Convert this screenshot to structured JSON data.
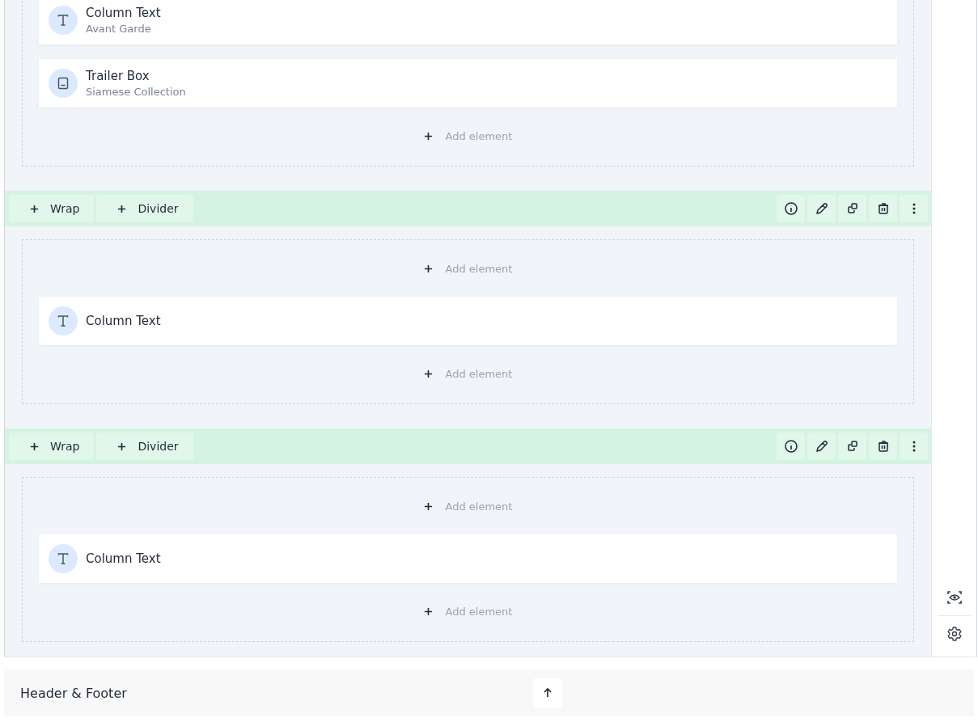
{
  "rows": [
    {
      "kind": "section",
      "add_top": null,
      "elements": [
        {
          "kind": "text",
          "title": "Column Text",
          "subtitle": "Avant Garde"
        },
        {
          "kind": "box",
          "title": "Trailer Box",
          "subtitle": "Siamese Collection"
        }
      ],
      "add_bottom": "Add element"
    },
    {
      "kind": "toolbar",
      "buttons": [
        {
          "label": "Wrap"
        },
        {
          "label": "Divider"
        }
      ]
    },
    {
      "kind": "section",
      "add_top": "Add element",
      "elements": [
        {
          "kind": "text",
          "title": "Column Text"
        }
      ],
      "add_bottom": "Add element"
    },
    {
      "kind": "toolbar",
      "buttons": [
        {
          "label": "Wrap"
        },
        {
          "label": "Divider"
        }
      ]
    },
    {
      "kind": "section",
      "add_top": "Add element",
      "elements": [
        {
          "kind": "text",
          "title": "Column Text"
        }
      ],
      "add_bottom": "Add element"
    }
  ],
  "footer": {
    "title": "Header & Footer"
  }
}
